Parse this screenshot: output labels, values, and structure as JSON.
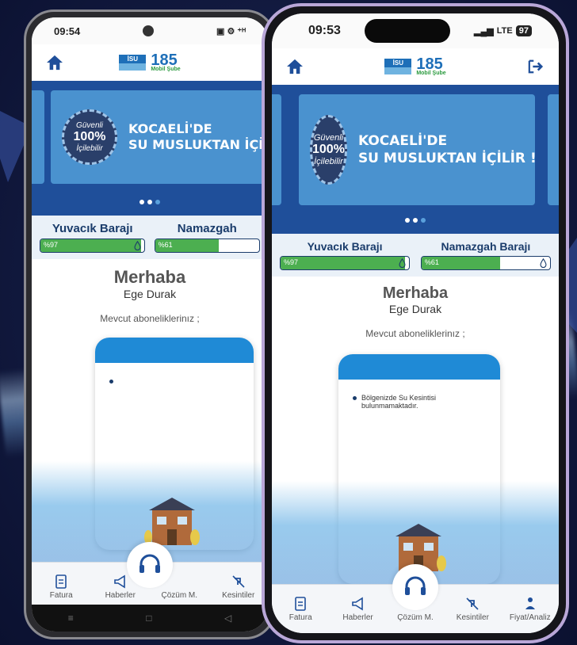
{
  "left_phone": {
    "status": {
      "time": "09:54",
      "icons": "▣ ⚙ ⁺ᴴ"
    },
    "slide_text_lines": [
      "KOCAELİ'DE",
      "SU MUSLUKTAN İÇİL"
    ],
    "dams": [
      {
        "name": "Yuvacık Barajı",
        "level_text": "%97",
        "level": 0.97
      },
      {
        "name": "Namazgah",
        "level_text": "%61",
        "level": 0.61
      }
    ],
    "greeting": "Merhaba",
    "user_name": "Ege Durak",
    "subscriptions_label": "Mevcut aboneliklerinız ;",
    "tabs": [
      "Fatura",
      "Haberler",
      "Çözüm M.",
      "Kesintiler"
    ]
  },
  "right_phone": {
    "status": {
      "time": "09:53",
      "network": "LTE",
      "battery": "97"
    },
    "slide_text_lines": [
      "KOCAELİ'DE",
      "SU MUSLUKTAN İÇİLİR !"
    ],
    "dams": [
      {
        "name": "Yuvacık Barajı",
        "level_text": "%97",
        "level": 0.97
      },
      {
        "name": "Namazgah Barajı",
        "level_text": "%61",
        "level": 0.61
      }
    ],
    "greeting": "Merhaba",
    "user_name": "Ege Durak",
    "subscriptions_label": "Mevcut aboneliklerinız ;",
    "notice": "Bölgenizde Su Kesintisi bulunmamaktadır.",
    "tabs": [
      "Fatura",
      "Haberler",
      "Çözüm M.",
      "Kesintiler",
      "Fiyat/Analiz"
    ]
  },
  "logo": {
    "brand": "İSU",
    "number": "185",
    "sub": "Mobil Şube"
  },
  "badge": {
    "top": "Güvenli",
    "pct": "100",
    "bottom": "İçilebilir"
  },
  "colors": {
    "primary": "#1f4f9a",
    "accent": "#1f8ad6",
    "level_fill": "#4caf50",
    "navy": "#1a3c6b"
  }
}
